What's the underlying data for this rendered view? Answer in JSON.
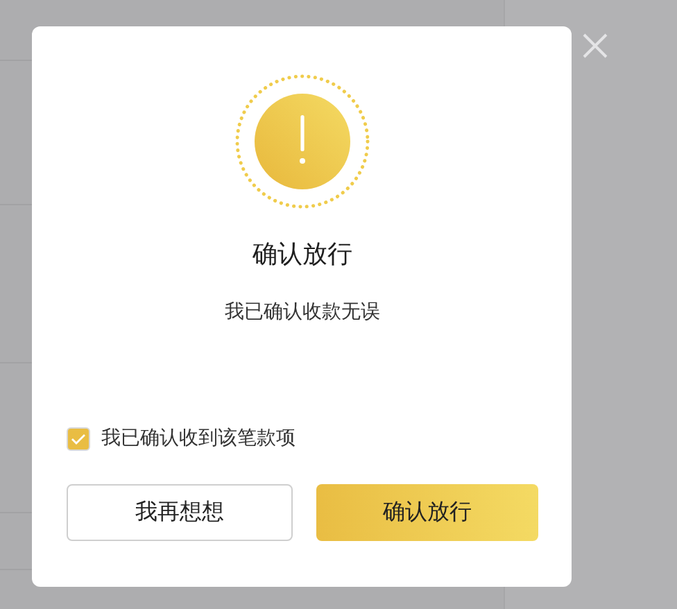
{
  "dialog": {
    "title": "确认放行",
    "message": "我已确认收款无误",
    "confirm_checkbox": {
      "label": "我已确认收到该笔款项",
      "checked": true
    },
    "buttons": [
      {
        "label": "我再想想",
        "kind": "secondary"
      },
      {
        "label": "确认放行",
        "kind": "primary"
      }
    ]
  }
}
